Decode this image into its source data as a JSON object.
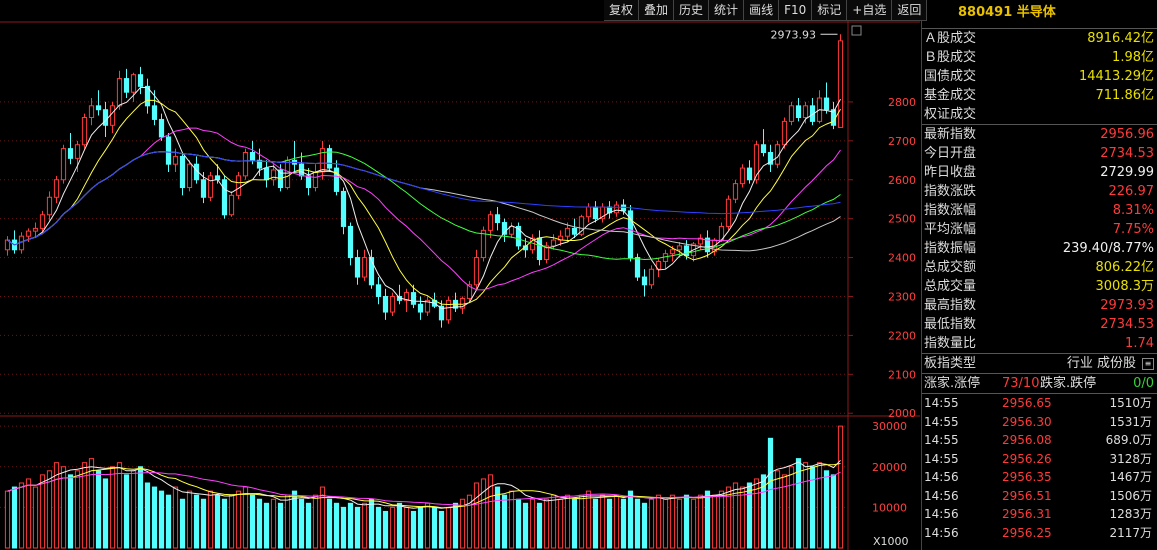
{
  "toolbar": {
    "items": [
      "复权",
      "叠加",
      "历史",
      "统计",
      "画线",
      "F10",
      "标记",
      "+自选",
      "返回"
    ]
  },
  "chart": {
    "peak_label": "2973.93",
    "price_ticks": [
      "2800",
      "2700",
      "2600",
      "2500",
      "2400",
      "2300",
      "2200",
      "2100",
      "2000"
    ],
    "vol_ticks": [
      "30000",
      "20000",
      "10000"
    ],
    "vol_unit": "X1000"
  },
  "chart_data": {
    "type": "candlestick",
    "candles": [
      [
        2420,
        2455,
        2405,
        2445
      ],
      [
        2445,
        2470,
        2410,
        2420
      ],
      [
        2420,
        2465,
        2410,
        2455
      ],
      [
        2455,
        2475,
        2440,
        2468
      ],
      [
        2468,
        2490,
        2450,
        2475
      ],
      [
        2475,
        2520,
        2460,
        2510
      ],
      [
        2510,
        2570,
        2495,
        2555
      ],
      [
        2555,
        2610,
        2540,
        2600
      ],
      [
        2600,
        2690,
        2590,
        2680
      ],
      [
        2680,
        2720,
        2640,
        2655
      ],
      [
        2655,
        2700,
        2620,
        2690
      ],
      [
        2690,
        2770,
        2680,
        2760
      ],
      [
        2760,
        2810,
        2740,
        2790
      ],
      [
        2790,
        2830,
        2765,
        2780
      ],
      [
        2780,
        2800,
        2710,
        2740
      ],
      [
        2740,
        2800,
        2720,
        2790
      ],
      [
        2790,
        2880,
        2780,
        2860
      ],
      [
        2860,
        2885,
        2810,
        2825
      ],
      [
        2825,
        2875,
        2800,
        2870
      ],
      [
        2870,
        2890,
        2820,
        2840
      ],
      [
        2840,
        2860,
        2770,
        2790
      ],
      [
        2790,
        2830,
        2740,
        2755
      ],
      [
        2755,
        2770,
        2700,
        2710
      ],
      [
        2710,
        2720,
        2620,
        2640
      ],
      [
        2640,
        2680,
        2620,
        2660
      ],
      [
        2660,
        2670,
        2560,
        2580
      ],
      [
        2580,
        2650,
        2570,
        2640
      ],
      [
        2640,
        2660,
        2590,
        2600
      ],
      [
        2600,
        2620,
        2540,
        2555
      ],
      [
        2555,
        2620,
        2545,
        2610
      ],
      [
        2610,
        2640,
        2590,
        2600
      ],
      [
        2600,
        2610,
        2500,
        2510
      ],
      [
        2510,
        2570,
        2505,
        2560
      ],
      [
        2560,
        2620,
        2550,
        2610
      ],
      [
        2610,
        2680,
        2600,
        2670
      ],
      [
        2670,
        2700,
        2640,
        2650
      ],
      [
        2650,
        2680,
        2610,
        2630
      ],
      [
        2630,
        2650,
        2580,
        2600
      ],
      [
        2600,
        2640,
        2585,
        2625
      ],
      [
        2625,
        2640,
        2570,
        2580
      ],
      [
        2580,
        2660,
        2575,
        2650
      ],
      [
        2650,
        2700,
        2620,
        2640
      ],
      [
        2640,
        2670,
        2600,
        2610
      ],
      [
        2610,
        2630,
        2560,
        2580
      ],
      [
        2580,
        2640,
        2570,
        2620
      ],
      [
        2620,
        2700,
        2600,
        2680
      ],
      [
        2680,
        2690,
        2620,
        2630
      ],
      [
        2630,
        2650,
        2560,
        2570
      ],
      [
        2570,
        2580,
        2460,
        2480
      ],
      [
        2480,
        2490,
        2380,
        2400
      ],
      [
        2400,
        2420,
        2330,
        2350
      ],
      [
        2350,
        2420,
        2340,
        2400
      ],
      [
        2400,
        2420,
        2320,
        2330
      ],
      [
        2330,
        2350,
        2280,
        2300
      ],
      [
        2300,
        2320,
        2240,
        2260
      ],
      [
        2260,
        2310,
        2250,
        2300
      ],
      [
        2300,
        2330,
        2280,
        2290
      ],
      [
        2290,
        2320,
        2260,
        2310
      ],
      [
        2310,
        2330,
        2270,
        2280
      ],
      [
        2280,
        2300,
        2240,
        2260
      ],
      [
        2260,
        2300,
        2250,
        2290
      ],
      [
        2290,
        2310,
        2270,
        2275
      ],
      [
        2275,
        2290,
        2220,
        2240
      ],
      [
        2240,
        2300,
        2230,
        2290
      ],
      [
        2290,
        2310,
        2260,
        2270
      ],
      [
        2270,
        2300,
        2255,
        2295
      ],
      [
        2295,
        2340,
        2285,
        2330
      ],
      [
        2330,
        2420,
        2320,
        2400
      ],
      [
        2400,
        2480,
        2390,
        2470
      ],
      [
        2470,
        2520,
        2450,
        2510
      ],
      [
        2510,
        2530,
        2470,
        2490
      ],
      [
        2490,
        2500,
        2440,
        2460
      ],
      [
        2460,
        2490,
        2450,
        2480
      ],
      [
        2480,
        2490,
        2420,
        2430
      ],
      [
        2430,
        2450,
        2400,
        2420
      ],
      [
        2420,
        2460,
        2410,
        2450
      ],
      [
        2450,
        2470,
        2380,
        2395
      ],
      [
        2395,
        2440,
        2385,
        2430
      ],
      [
        2430,
        2460,
        2420,
        2445
      ],
      [
        2445,
        2470,
        2430,
        2455
      ],
      [
        2455,
        2490,
        2440,
        2475
      ],
      [
        2475,
        2500,
        2450,
        2460
      ],
      [
        2460,
        2510,
        2455,
        2505
      ],
      [
        2505,
        2540,
        2490,
        2530
      ],
      [
        2530,
        2545,
        2490,
        2500
      ],
      [
        2500,
        2540,
        2490,
        2530
      ],
      [
        2530,
        2545,
        2500,
        2515
      ],
      [
        2515,
        2545,
        2505,
        2535
      ],
      [
        2535,
        2550,
        2510,
        2520
      ],
      [
        2520,
        2535,
        2390,
        2400
      ],
      [
        2400,
        2410,
        2340,
        2350
      ],
      [
        2350,
        2370,
        2300,
        2330
      ],
      [
        2330,
        2380,
        2320,
        2370
      ],
      [
        2370,
        2400,
        2350,
        2390
      ],
      [
        2390,
        2420,
        2370,
        2410
      ],
      [
        2410,
        2430,
        2390,
        2420
      ],
      [
        2420,
        2440,
        2400,
        2430
      ],
      [
        2430,
        2445,
        2395,
        2405
      ],
      [
        2405,
        2440,
        2390,
        2435
      ],
      [
        2435,
        2460,
        2420,
        2450
      ],
      [
        2450,
        2470,
        2400,
        2415
      ],
      [
        2415,
        2450,
        2405,
        2445
      ],
      [
        2445,
        2490,
        2440,
        2480
      ],
      [
        2480,
        2560,
        2470,
        2550
      ],
      [
        2550,
        2600,
        2540,
        2590
      ],
      [
        2590,
        2640,
        2580,
        2630
      ],
      [
        2630,
        2650,
        2590,
        2600
      ],
      [
        2600,
        2700,
        2590,
        2690
      ],
      [
        2690,
        2730,
        2660,
        2670
      ],
      [
        2670,
        2690,
        2620,
        2640
      ],
      [
        2640,
        2700,
        2630,
        2690
      ],
      [
        2690,
        2760,
        2680,
        2750
      ],
      [
        2750,
        2800,
        2740,
        2790
      ],
      [
        2790,
        2810,
        2750,
        2760
      ],
      [
        2760,
        2800,
        2745,
        2790
      ],
      [
        2790,
        2810,
        2740,
        2750
      ],
      [
        2750,
        2830,
        2745,
        2810
      ],
      [
        2810,
        2850,
        2770,
        2780
      ],
      [
        2780,
        2800,
        2730,
        2740
      ],
      [
        2734.53,
        2973.93,
        2734.53,
        2956.96
      ]
    ],
    "volumes": [
      14,
      15,
      16,
      17,
      15,
      18,
      19,
      21,
      20,
      18,
      19,
      21,
      22,
      19,
      17,
      20,
      21,
      18,
      19,
      20,
      16,
      15,
      14,
      13,
      15,
      12,
      14,
      13,
      12,
      14,
      13,
      12,
      13,
      14,
      15,
      13,
      12,
      11,
      12,
      11,
      13,
      14,
      12,
      11,
      13,
      15,
      12,
      11,
      10,
      11,
      10,
      11,
      12,
      10,
      9,
      10,
      11,
      10,
      9,
      10,
      11,
      10,
      9,
      10,
      11,
      12,
      13,
      16,
      17,
      18,
      15,
      13,
      14,
      12,
      11,
      12,
      11,
      12,
      13,
      12,
      13,
      12,
      13,
      14,
      12,
      13,
      12,
      13,
      12,
      14,
      12,
      11,
      12,
      13,
      12,
      13,
      12,
      13,
      12,
      13,
      14,
      13,
      14,
      15,
      16,
      15,
      16,
      17,
      18,
      27,
      19,
      18,
      20,
      22,
      21,
      20,
      21,
      19,
      18,
      30
    ]
  },
  "side": {
    "title": "880491 半导体",
    "rows1": [
      {
        "label": "Ａ股成交",
        "value": "8916.42亿",
        "cls": "yellow"
      },
      {
        "label": "Ｂ股成交",
        "value": "1.98亿",
        "cls": "yellow"
      },
      {
        "label": "国债成交",
        "value": "14413.29亿",
        "cls": "yellow"
      },
      {
        "label": "基金成交",
        "value": "711.86亿",
        "cls": "yellow"
      },
      {
        "label": "权证成交",
        "value": "",
        "cls": "yellow"
      }
    ],
    "rows2": [
      {
        "label": "最新指数",
        "value": "2956.96",
        "cls": "red"
      },
      {
        "label": "今日开盘",
        "value": "2734.53",
        "cls": "red"
      },
      {
        "label": "昨日收盘",
        "value": "2729.99",
        "cls": "white"
      },
      {
        "label": "指数涨跌",
        "value": "226.97",
        "cls": "red"
      },
      {
        "label": "指数涨幅",
        "value": "8.31%",
        "cls": "red"
      },
      {
        "label": "平均涨幅",
        "value": "7.75%",
        "cls": "red"
      },
      {
        "label": "指数振幅",
        "value": "239.40/8.77%",
        "cls": "white"
      },
      {
        "label": "总成交额",
        "value": "806.22亿",
        "cls": "yellow"
      },
      {
        "label": "总成交量",
        "value": "3008.3万",
        "cls": "yellow"
      },
      {
        "label": "最高指数",
        "value": "2973.93",
        "cls": "red"
      },
      {
        "label": "最低指数",
        "value": "2734.53",
        "cls": "red"
      },
      {
        "label": "指数量比",
        "value": "1.74",
        "cls": "red"
      }
    ],
    "type_row": {
      "label": "板指类型",
      "value": "行业 成份股"
    },
    "updown": {
      "l1": "涨家.涨停",
      "v1": "73/10",
      "l2": "跌家.跌停",
      "v2": "0/0"
    },
    "ticks": [
      {
        "t": "14:55",
        "p": "2956.65",
        "v": "1510万"
      },
      {
        "t": "14:55",
        "p": "2956.30",
        "v": "1531万"
      },
      {
        "t": "14:55",
        "p": "2956.08",
        "v": "689.0万"
      },
      {
        "t": "14:55",
        "p": "2956.26",
        "v": "3128万"
      },
      {
        "t": "14:56",
        "p": "2956.35",
        "v": "1467万"
      },
      {
        "t": "14:56",
        "p": "2956.51",
        "v": "1506万"
      },
      {
        "t": "14:56",
        "p": "2956.31",
        "v": "1283万"
      },
      {
        "t": "14:56",
        "p": "2956.25",
        "v": "2117万"
      }
    ]
  }
}
